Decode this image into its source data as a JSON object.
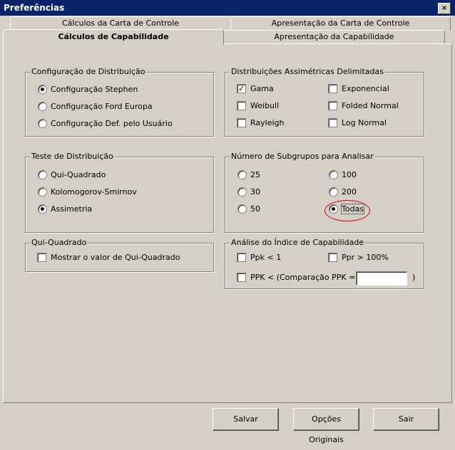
{
  "window": {
    "title": "Preferências",
    "close": "×"
  },
  "tabs": {
    "row1": [
      "Cálculos da Carta de Controle",
      "Apresentação da Carta de Controle"
    ],
    "row2": [
      "Cálculos de Capabilidade",
      "Apresentação da Capabilidade"
    ]
  },
  "dist_config": {
    "title": "Configuração de Distribuição",
    "options": [
      "Configuração Stephen",
      "Configuração Ford Europa",
      "Configuração Def. pelo Usuário"
    ],
    "selected": 0
  },
  "dist_test": {
    "title": "Teste de Distribuição",
    "options": [
      "Qui-Quadrado",
      "Kolomogorov-Smirnov",
      "Assimetria"
    ],
    "selected": 2
  },
  "chi_square": {
    "title": "Qui-Quadrado",
    "show_label": "Mostrar o valor de Qui-Quadrado",
    "checked": false
  },
  "asym_dist": {
    "title": "Distribuições Assimétricas Delimitadas",
    "options": [
      "Gama",
      "Exponencial",
      "Weibull",
      "Folded Normal",
      "Rayleigh",
      "Log Normal"
    ],
    "checked": [
      true,
      false,
      false,
      false,
      false,
      false
    ]
  },
  "subgroups": {
    "title": "Número de Subgrupos para Analisar",
    "options": [
      "25",
      "100",
      "30",
      "200",
      "50",
      "Todas"
    ],
    "selected": 5
  },
  "cap_index": {
    "title": "Análise do Índice de Capabilidade",
    "ppk": "Ppk < 1",
    "ppr": "Ppr > 100%",
    "ppk_compare": "PPK < (Comparação PPK =",
    "ppk_close": ")",
    "ppk_value": ""
  },
  "buttons": {
    "save": "Salvar",
    "defaults": "Opções Originais",
    "exit": "Sair"
  },
  "accent": {
    "titlebar": "#0a246a",
    "highlight": "#e00000"
  }
}
